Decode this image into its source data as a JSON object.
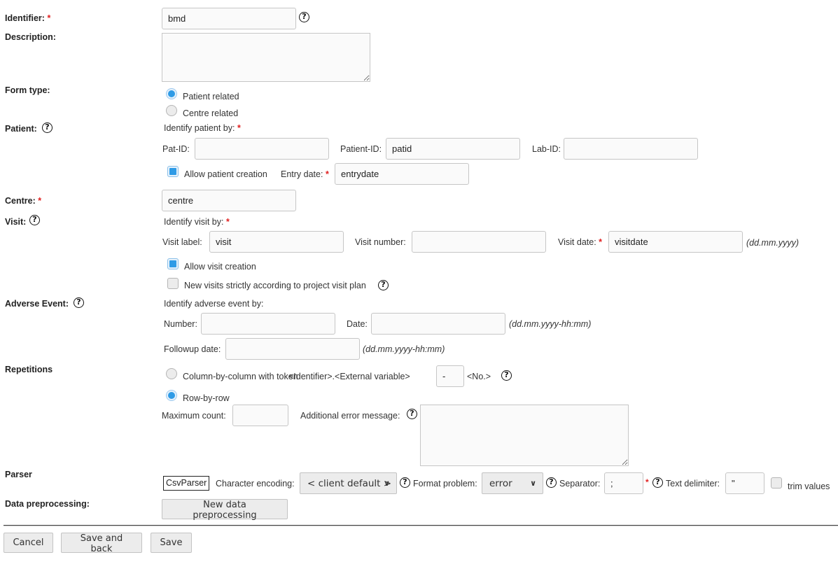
{
  "identifier": {
    "label": "Identifier:",
    "value": "bmd"
  },
  "description": {
    "label": "Description:",
    "value": ""
  },
  "form_type": {
    "label": "Form type:",
    "options": [
      {
        "label": "Patient related",
        "selected": true
      },
      {
        "label": "Centre related",
        "selected": false
      }
    ]
  },
  "patient": {
    "label": "Patient:",
    "identify_by": "Identify patient by:",
    "pat_id": {
      "label": "Pat-ID:",
      "value": ""
    },
    "patient_id": {
      "label": "Patient-ID:",
      "value": "patid"
    },
    "lab_id": {
      "label": "Lab-ID:",
      "value": ""
    },
    "allow_creation": {
      "label": "Allow patient creation",
      "checked": true
    },
    "entry_date": {
      "label": "Entry date:",
      "value": "entrydate"
    }
  },
  "centre": {
    "label": "Centre:",
    "value": "centre"
  },
  "visit": {
    "label": "Visit:",
    "identify_by": "Identify visit by:",
    "visit_label": {
      "label": "Visit label:",
      "value": "visit"
    },
    "visit_number": {
      "label": "Visit number:",
      "value": ""
    },
    "visit_date": {
      "label": "Visit date:",
      "value": "visitdate",
      "format": "(dd.mm.yyyy)"
    },
    "allow_creation": {
      "label": "Allow visit creation",
      "checked": true
    },
    "strict_plan": {
      "label": "New visits strictly according to project visit plan",
      "checked": false
    }
  },
  "adverse_event": {
    "label": "Adverse Event:",
    "identify_by": "Identify adverse event by:",
    "number": {
      "label": "Number:",
      "value": ""
    },
    "date": {
      "label": "Date:",
      "value": "",
      "format": "(dd.mm.yyyy-hh:mm)"
    },
    "followup_date": {
      "label": "Followup date:",
      "value": "",
      "format": "(dd.mm.yyyy-hh:mm)"
    }
  },
  "repetitions": {
    "label": "Repetitions",
    "column_by_column": {
      "label": "Column-by-column with token",
      "token_prefix": "<Identifier>.<External variable>",
      "token_value": "-",
      "token_suffix": "<No.>",
      "selected": false
    },
    "row_by_row": {
      "label": "Row-by-row",
      "selected": true
    },
    "maximum_count": {
      "label": "Maximum count:",
      "value": ""
    },
    "additional_error": {
      "label": "Additional error message:",
      "value": ""
    }
  },
  "parser": {
    "label": "Parser",
    "name": "CsvParser",
    "encoding": {
      "label": "Character encoding:",
      "value": "< client default >"
    },
    "format_problem": {
      "label": "Format problem:",
      "value": "error"
    },
    "separator": {
      "label": "Separator:",
      "value": ";"
    },
    "text_delimiter": {
      "label": "Text delimiter:",
      "value": "\""
    },
    "trim_values": {
      "label": "trim values",
      "checked": false
    }
  },
  "data_preprocessing": {
    "label": "Data preprocessing:",
    "button": "New data preprocessing"
  },
  "footer": {
    "cancel": "Cancel",
    "save_and_back": "Save and back",
    "save": "Save"
  },
  "symbols": {
    "required": "*",
    "help": "?",
    "chevron": "⌄"
  }
}
